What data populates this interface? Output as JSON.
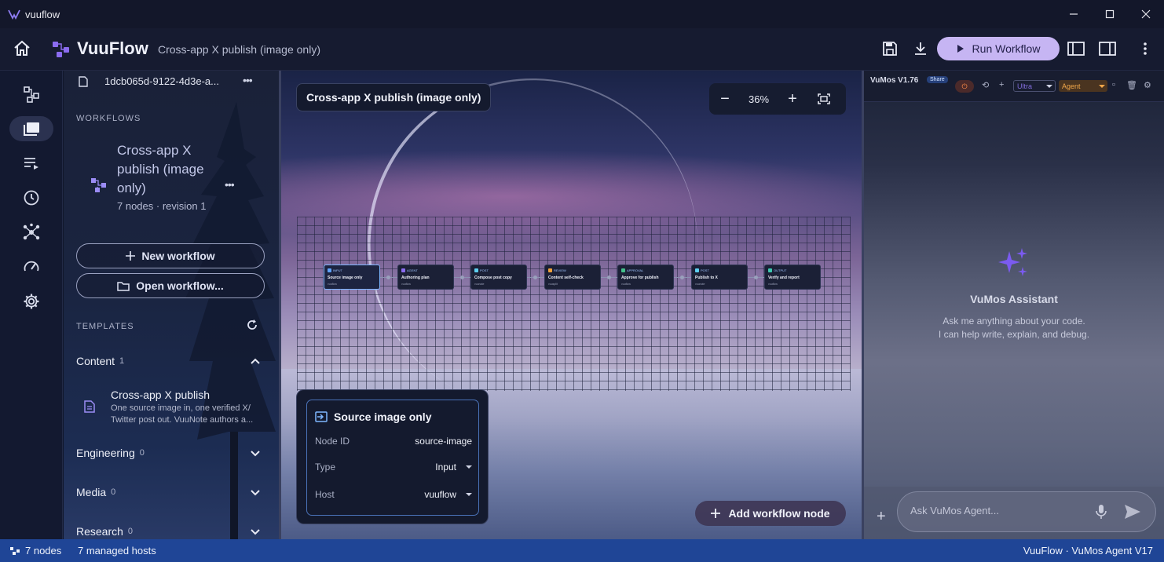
{
  "window": {
    "app_name": "vuuflow",
    "controls": [
      "minimize",
      "maximize",
      "close"
    ]
  },
  "header": {
    "brand": "VuuFlow",
    "subtitle": "Cross-app X publish (image only)",
    "run_label": "Run Workflow"
  },
  "sidebar": {
    "file_id": "1dcb065d-9122-4d3e-a...",
    "workflows_heading": "WORKFLOWS",
    "workflow": {
      "title": "Cross-app X publish (image only)",
      "meta": "7 nodes · revision 1"
    },
    "new_workflow": "New workflow",
    "open_workflow": "Open workflow...",
    "templates_heading": "TEMPLATES",
    "categories": [
      {
        "label": "Content",
        "count": "1",
        "expanded": true
      },
      {
        "label": "Engineering",
        "count": "0"
      },
      {
        "label": "Media",
        "count": "0"
      },
      {
        "label": "Research",
        "count": "0"
      }
    ],
    "template": {
      "title": "Cross-app X publish",
      "desc": "One source image in, one verified X/ Twitter post out. VuuNote authors a..."
    }
  },
  "canvas": {
    "title": "Cross-app X publish (image only)",
    "zoom": "36%",
    "nodes": [
      {
        "tag": "INPUT",
        "title": "Source image only",
        "host": "vuuflow",
        "color": "#5fa4ff",
        "selected": true
      },
      {
        "tag": "AGENT",
        "title": "Authoring plan",
        "host": "vuuflow",
        "color": "#8b6cf0"
      },
      {
        "tag": "POST",
        "title": "Compose post copy",
        "host": "vuunote",
        "color": "#5ecff0"
      },
      {
        "tag": "REVIEW",
        "title": "Content self-check",
        "host": "vuusplit",
        "color": "#f0a23c"
      },
      {
        "tag": "APPROVAL",
        "title": "Approve for publish",
        "host": "vuuflow",
        "color": "#43c08a"
      },
      {
        "tag": "POST",
        "title": "Publish to X",
        "host": "vuunote",
        "color": "#5ecff0"
      },
      {
        "tag": "OUTPUT",
        "title": "Verify and report",
        "host": "vuuflow",
        "color": "#3fc9b0"
      }
    ],
    "props": {
      "title": "Source image only",
      "rows": [
        {
          "key": "Node ID",
          "value": "source-image",
          "dropdown": false
        },
        {
          "key": "Type",
          "value": "Input",
          "dropdown": true
        },
        {
          "key": "Host",
          "value": "vuuflow",
          "dropdown": true
        }
      ]
    },
    "add_node": "Add workflow node"
  },
  "assistant": {
    "version": "VuMos V1.76",
    "share": "Share",
    "model": "Ultra",
    "mode": "Agent",
    "title": "VuMos Assistant",
    "subtitle_line1": "Ask me anything about your code.",
    "subtitle_line2": "I can help write, explain, and debug.",
    "placeholder": "Ask VuMos Agent..."
  },
  "status": {
    "nodes": "7 nodes",
    "hosts": "7 managed hosts",
    "right": "VuuFlow · VuMos Agent V17"
  }
}
